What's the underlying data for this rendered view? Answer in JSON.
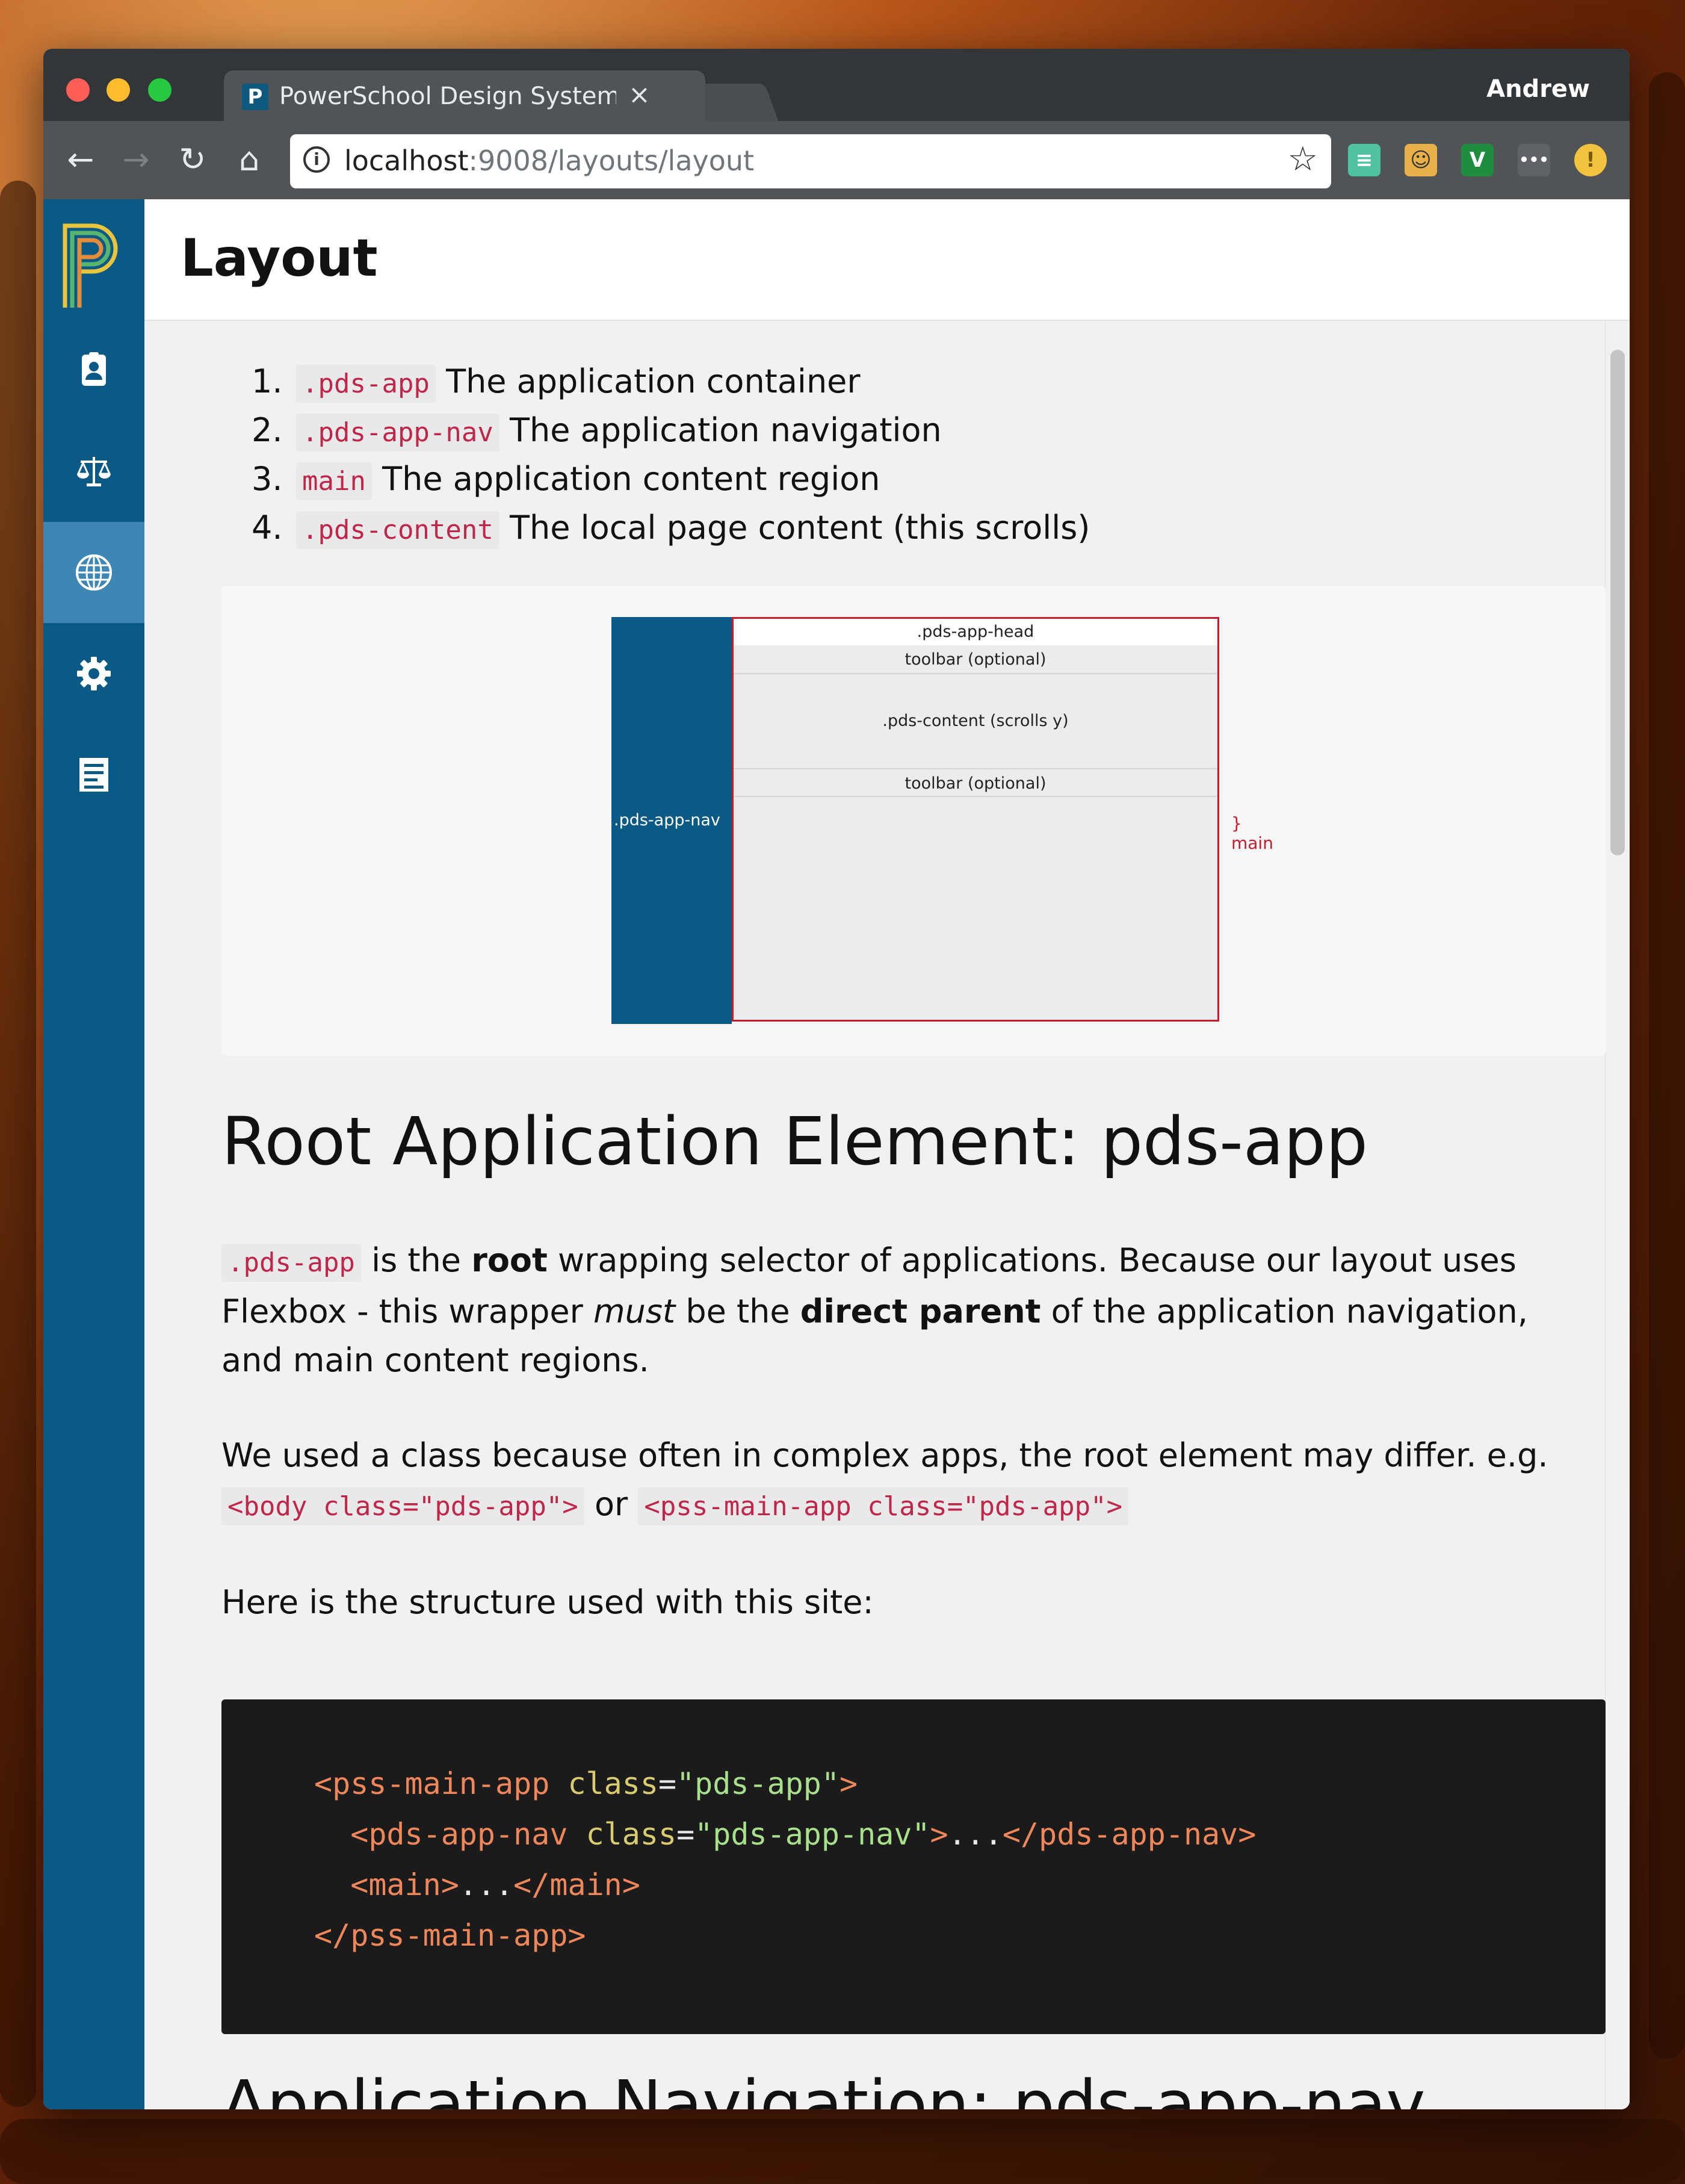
{
  "browser": {
    "tab_title": "PowerSchool Design System S",
    "tab_close": "×",
    "profile_name": "Andrew",
    "url_host": "localhost",
    "url_path": ":9008/layouts/layout",
    "icons": [
      "back-icon",
      "forward-icon",
      "reload-icon",
      "home-icon",
      "info-icon",
      "star-icon"
    ],
    "extensions": [
      {
        "name": "extension-teal",
        "color": "#4fc3a1",
        "glyph": "≡"
      },
      {
        "name": "extension-face",
        "color": "#e8b04a",
        "glyph": "☺"
      },
      {
        "name": "extension-v",
        "color": "#1e8e3e",
        "glyph": "V"
      },
      {
        "name": "extension-dots",
        "color": "#5f6368",
        "glyph": "•••"
      },
      {
        "name": "extension-alert",
        "color": "#f2c33d",
        "glyph": "!"
      }
    ]
  },
  "app_nav": {
    "color": "#0b5a86",
    "active_color": "#3e86b4",
    "items": [
      {
        "name": "nav-item-contacts",
        "icon": "contact-card-icon",
        "active": false
      },
      {
        "name": "nav-item-balance",
        "icon": "scales-icon",
        "active": false
      },
      {
        "name": "nav-item-globe",
        "icon": "globe-icon",
        "active": true
      },
      {
        "name": "nav-item-settings",
        "icon": "gear-icon",
        "active": false
      },
      {
        "name": "nav-item-docs",
        "icon": "document-list-icon",
        "active": false
      }
    ]
  },
  "page": {
    "title": "Layout",
    "list": [
      {
        "num": "1.",
        "code": ".pds-app",
        "text": " The application container"
      },
      {
        "num": "2.",
        "code": ".pds-app-nav",
        "text": " The application navigation"
      },
      {
        "num": "3.",
        "code": "main",
        "text": " The application content region"
      },
      {
        "num": "4.",
        "code": ".pds-content",
        "text": " The local page content (this scrolls)"
      }
    ],
    "diagram": {
      "nav_label": ".pds-app-nav",
      "head_label": ".pds-app-head",
      "toolbar_top": "toolbar (optional)",
      "content_label": ".pds-content (scrolls y)",
      "toolbar_bottom": "toolbar (optional)",
      "main_label": "} main"
    },
    "section_title": "Root Application Element: pds-app",
    "para1": {
      "code": ".pds-app",
      "t1": " is the ",
      "b1": "root",
      "t2": " wrapping selector of applications. Because our layout uses Flexbox - this wrapper ",
      "i1": "must",
      "t3": " be the ",
      "b2": "direct parent",
      "t4": " of the application navigation, and main content regions."
    },
    "para2": {
      "text": "We used a class because often in complex apps, the root element may differ. e.g.",
      "code1": "<body class=\"pds-app\">",
      "or": " or ",
      "code2": "<pss-main-app class=\"pds-app\">"
    },
    "para3": "Here is the structure used with this site:",
    "code_lines": {
      "l1_open": "<pss-main-app",
      "l1_attr": "class",
      "l1_eq": "=",
      "l1_val": "\"pds-app\"",
      "l1_close": ">",
      "l2_open": "<pds-app-nav",
      "l2_attr": "class",
      "l2_eq": "=",
      "l2_val": "\"pds-app-nav\"",
      "l2_close": ">",
      "l2_dots": "...",
      "l2_end": "</pds-app-nav>",
      "l3_open": "<main>",
      "l3_dots": "...",
      "l3_end": "</main>",
      "l4_end": "</pss-main-app>"
    },
    "next_section_title": "Application Navigation: pds-app-nav"
  }
}
